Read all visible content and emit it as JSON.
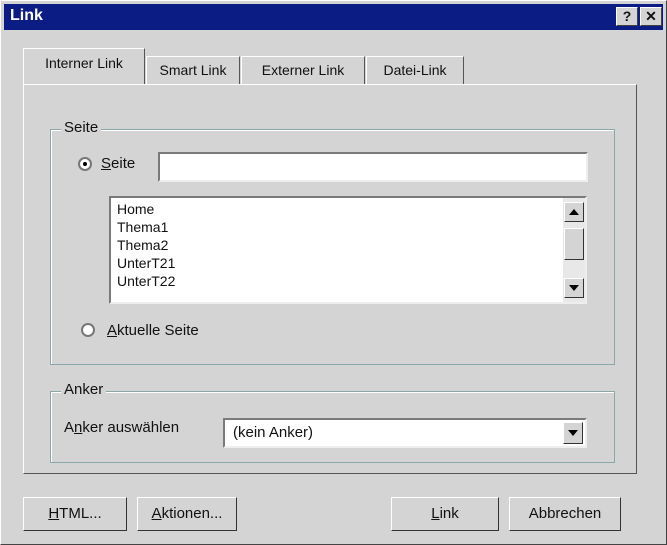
{
  "window": {
    "title": "Link",
    "help_btn": "?",
    "close_btn": "✕"
  },
  "tabs": [
    {
      "label": "Interner Link"
    },
    {
      "label": "Smart Link"
    },
    {
      "label": "Externer Link"
    },
    {
      "label": "Datei-Link"
    }
  ],
  "seite_group": {
    "title": "Seite",
    "radio_seite": {
      "accel": "S",
      "rest": "eite",
      "selected": true
    },
    "seite_value": "",
    "pages": [
      "Home",
      "Thema1",
      "Thema2",
      "UnterT21",
      "UnterT22"
    ],
    "radio_aktuelle": {
      "accel": "A",
      "rest": "ktuelle Seite",
      "selected": false
    }
  },
  "anker_group": {
    "title": "Anker",
    "label_pre": "A",
    "label_accel": "n",
    "label_post": "ker auswählen",
    "selected": "(kein Anker)"
  },
  "buttons": {
    "html": {
      "accel": "H",
      "rest": "TML..."
    },
    "aktionen": {
      "accel": "A",
      "rest": "ktionen..."
    },
    "link": {
      "accel": "L",
      "rest": "ink"
    },
    "abbrechen": "Abbrechen"
  },
  "colors": {
    "titlebar": "#0b1c84",
    "face": "#d4d4d4"
  }
}
